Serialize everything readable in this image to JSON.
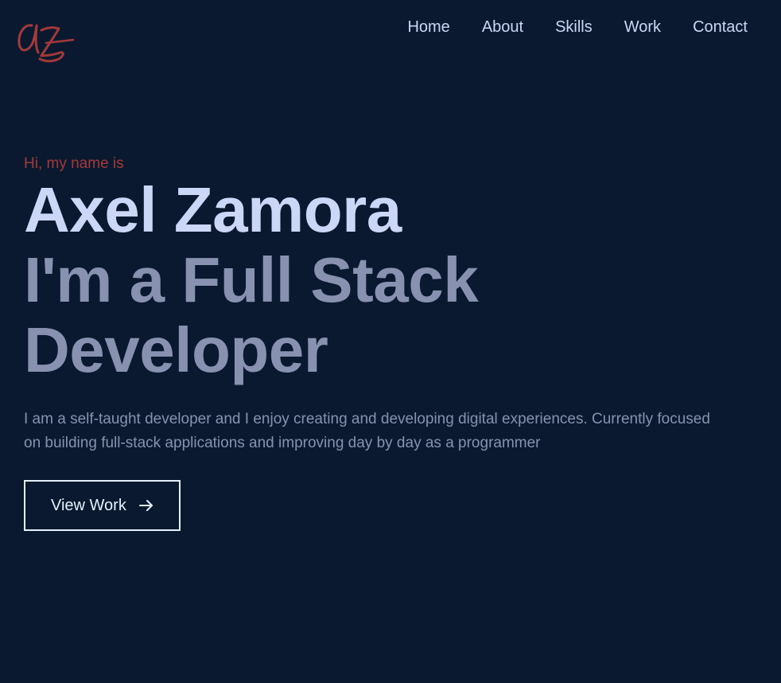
{
  "brand": {
    "logo_text": "az",
    "logo_color": "#a33a3a"
  },
  "nav": {
    "items": [
      {
        "label": "Home"
      },
      {
        "label": "About"
      },
      {
        "label": "Skills"
      },
      {
        "label": "Work"
      },
      {
        "label": "Contact"
      }
    ]
  },
  "hero": {
    "greeting": "Hi, my name is",
    "name": "Axel Zamora",
    "role": "I'm a Full Stack Developer",
    "description": "I am a self-taught developer and I enjoy creating and developing digital experiences. Currently focused on building full-stack applications and improving day by day as a programmer",
    "cta_label": "View Work",
    "cta_icon": "arrow-right-icon"
  },
  "colors": {
    "background": "#0a192f",
    "accent": "#a33a3a",
    "heading": "#ccd6f6",
    "muted": "#8892b0"
  }
}
